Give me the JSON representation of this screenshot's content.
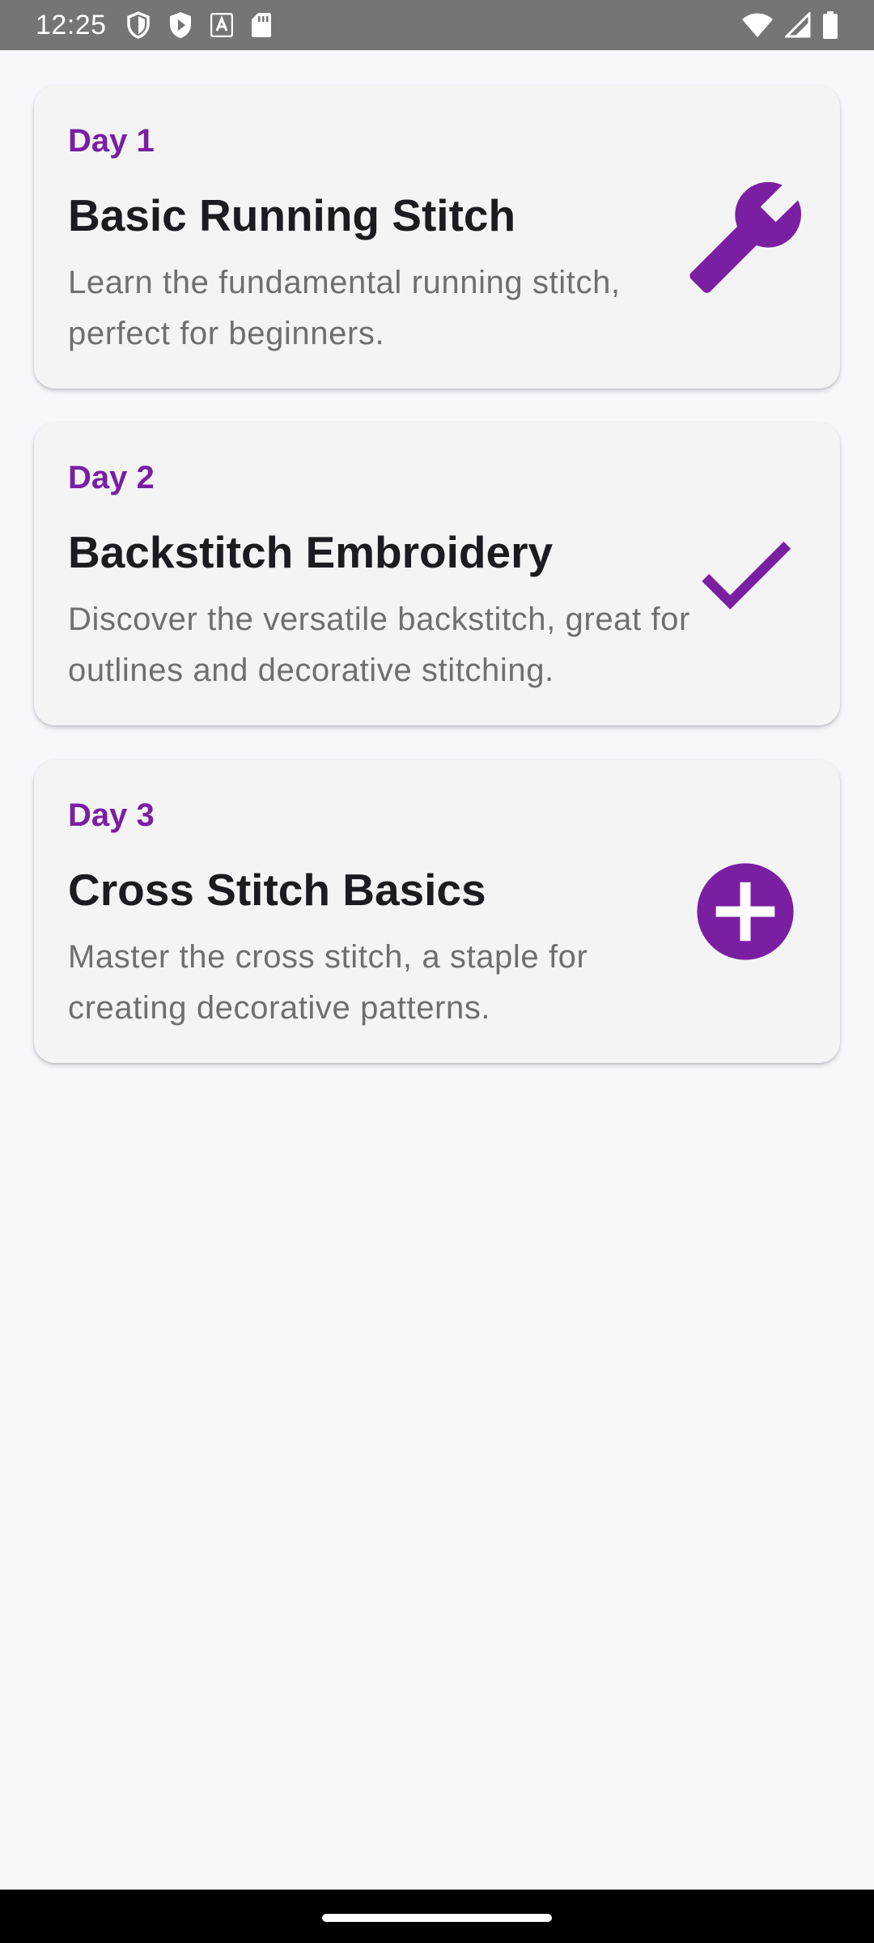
{
  "status_bar": {
    "time": "12:25",
    "left_icons": [
      "shield-icon",
      "play-protect-icon",
      "font-a-icon",
      "sd-card-icon"
    ],
    "right_icons": [
      "wifi-icon",
      "signal-icon",
      "battery-icon"
    ]
  },
  "lessons": [
    {
      "day": "Day 1",
      "title": "Basic Running Stitch",
      "description": "Learn the fundamental running stitch, perfect for beginners.",
      "icon": "wrench-icon"
    },
    {
      "day": "Day 2",
      "title": "Backstitch Embroidery",
      "description": "Discover the versatile backstitch, great for outlines and decorative stitching.",
      "icon": "check-icon"
    },
    {
      "day": "Day 3",
      "title": "Cross Stitch Basics",
      "description": "Master the cross stitch, a staple for creating decorative patterns.",
      "icon": "add-circle-icon"
    }
  ],
  "colors": {
    "accent": "#7b1fa2",
    "card_background": "#f4f4f5",
    "page_background": "#f8f7fc",
    "title_text": "#1c1b1f",
    "body_text": "#6f6f6f"
  }
}
